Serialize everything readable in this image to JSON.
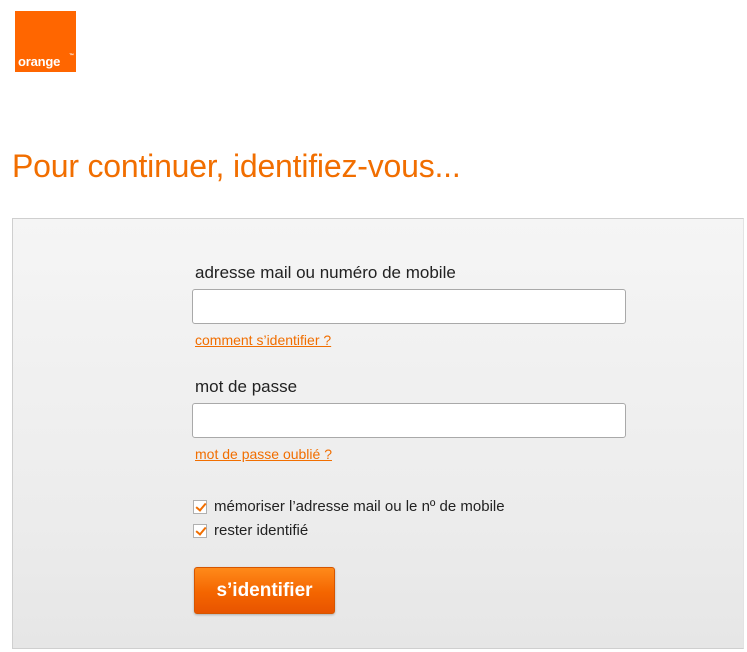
{
  "brand": {
    "logo_text": "orange",
    "logo_tm": "™",
    "color": "#ff6600",
    "accent": "#f16e00"
  },
  "page_title": "Pour continuer, identifiez-vous...",
  "login_form": {
    "login_label": "adresse mail ou numéro de mobile",
    "login_value": "",
    "login_help_link": "comment s’identifier ?",
    "password_label": "mot de passe",
    "password_value": "",
    "password_help_link": "mot de passe oublié ?",
    "checkboxes": [
      {
        "label": "mémoriser l’adresse mail ou le nº de mobile",
        "checked": true
      },
      {
        "label": "rester identifié",
        "checked": true
      }
    ],
    "submit_label": "s’identifier"
  }
}
